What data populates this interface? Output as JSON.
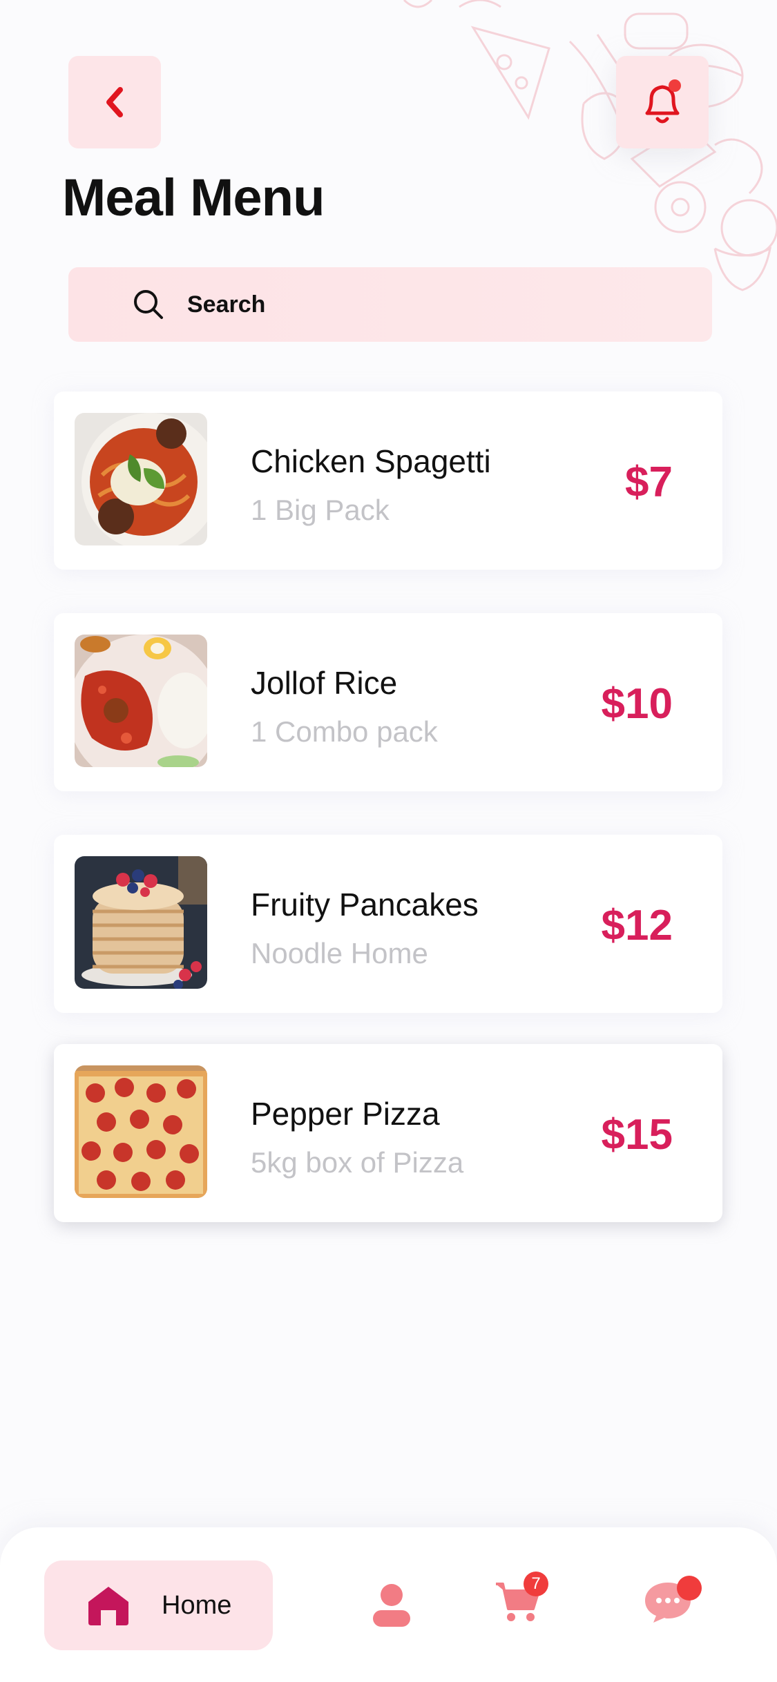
{
  "header": {
    "title": "Meal Menu"
  },
  "search": {
    "placeholder": "Search"
  },
  "meals": [
    {
      "name": "Chicken Spagetti",
      "subtitle": "1 Big Pack",
      "price": "$7"
    },
    {
      "name": "Jollof Rice",
      "subtitle": "1 Combo pack",
      "price": "$10"
    },
    {
      "name": "Fruity Pancakes",
      "subtitle": "Noodle Home",
      "price": "$12"
    },
    {
      "name": "Pepper Pizza",
      "subtitle": "5kg box of Pizza",
      "price": "$15"
    }
  ],
  "nav": {
    "home_label": "Home",
    "cart_count": "7"
  },
  "colors": {
    "accent": "#d81f5b",
    "soft_pink": "#fde3e8",
    "nav_icon": "#f27c84",
    "badge": "#f03c3c"
  },
  "icons": [
    "chevron-left-icon",
    "bell-icon",
    "search-icon",
    "home-icon",
    "profile-icon",
    "cart-icon",
    "chat-icon"
  ]
}
